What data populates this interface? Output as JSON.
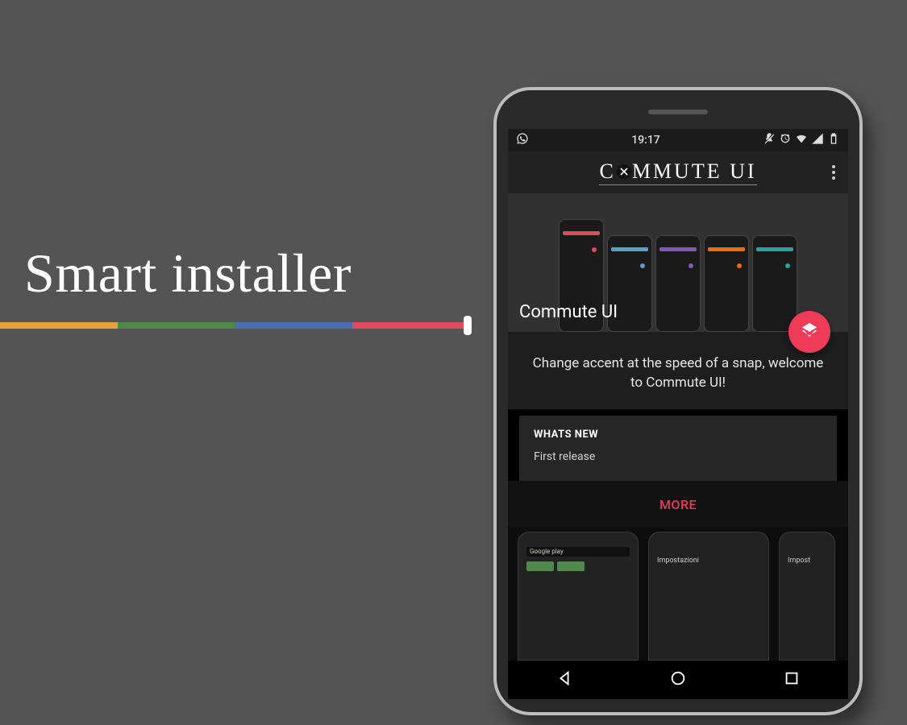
{
  "headline": "Smart installer",
  "statusbar": {
    "time": "19:17"
  },
  "appbar": {
    "title_left": "C",
    "title_right": "MMUTE UI"
  },
  "hero": {
    "title": "Commute UI"
  },
  "tagline": "Change accent at the speed of a snap, welcome to Commute UI!",
  "whatsnew": {
    "heading": "WHATS NEW",
    "body": "First release"
  },
  "more_label": "MORE",
  "thumbs": {
    "t1_label": "Google play",
    "t2_label": "Impostazioni",
    "t3_label": "Impost"
  },
  "colors": {
    "accent": "#ef3b5a"
  }
}
